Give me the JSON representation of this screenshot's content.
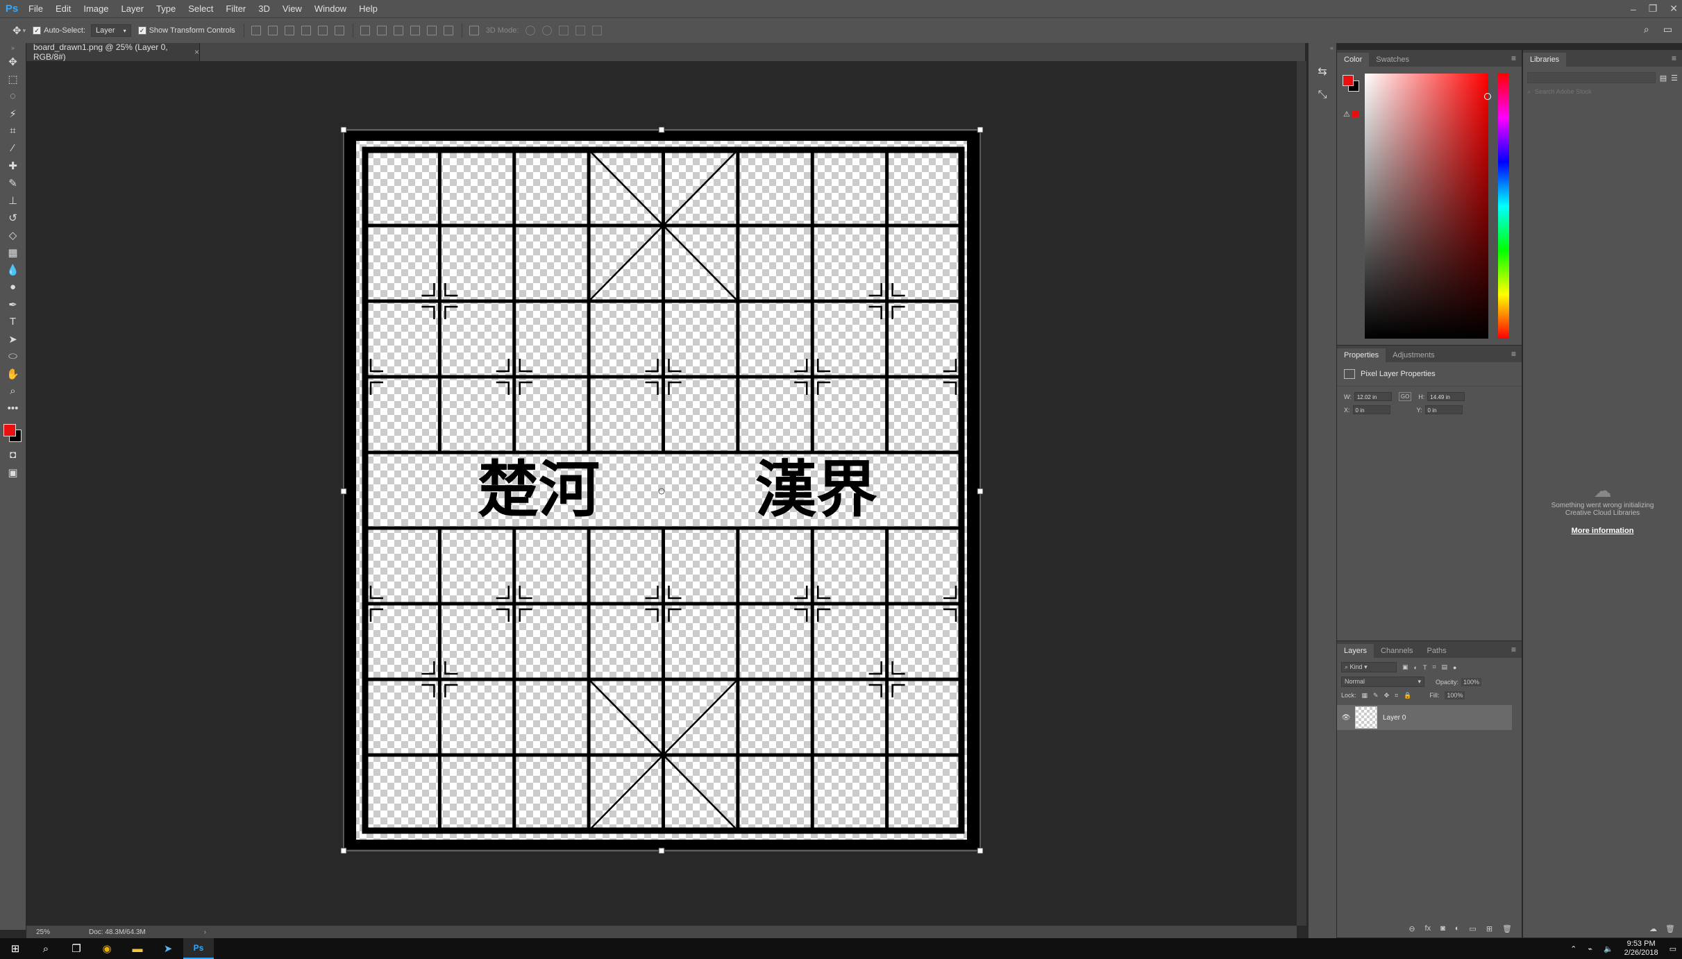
{
  "app": {
    "logo": "Ps"
  },
  "menu": [
    "File",
    "Edit",
    "Image",
    "Layer",
    "Type",
    "Select",
    "Filter",
    "3D",
    "View",
    "Window",
    "Help"
  ],
  "window_controls": [
    "–",
    "❐",
    "✕"
  ],
  "options": {
    "auto_select_label": "Auto-Select:",
    "auto_select_value": "Layer",
    "transform_label": "Show Transform Controls",
    "mode_3d_label": "3D Mode:"
  },
  "document": {
    "tab_title": "board_drawn1.png @ 25% (Layer 0, RGB/8#)",
    "tab_close": "×",
    "river_left": "楚河",
    "river_right": "漢界",
    "zoom": "25%",
    "doc_info": "Doc: 48.3M/64.3M"
  },
  "color_panel": {
    "tabs": [
      "Color",
      "Swatches"
    ],
    "fg": "#e80f0f",
    "bg": "#000000"
  },
  "properties_panel": {
    "tabs": [
      "Properties",
      "Adjustments"
    ],
    "title": "Pixel Layer Properties",
    "w_label": "W:",
    "w_value": "12.02 in",
    "h_label": "H:",
    "h_value": "14.49 in",
    "x_label": "X:",
    "x_value": "0 in",
    "y_label": "Y:",
    "y_value": "0 in",
    "link": "GO"
  },
  "layers_panel": {
    "tabs": [
      "Layers",
      "Channels",
      "Paths"
    ],
    "filter": "Kind",
    "blend": "Normal",
    "opacity_label": "Opacity:",
    "opacity": "100%",
    "lock_label": "Lock:",
    "fill_label": "Fill:",
    "fill": "100%",
    "layer_name": "Layer 0"
  },
  "libraries_panel": {
    "tab": "Libraries",
    "search_placeholder": "Search Adobe Stock",
    "error_line1": "Something went wrong initializing",
    "error_line2": "Creative Cloud Libraries",
    "more_info": "More information"
  },
  "taskbar": {
    "time": "9:53 PM",
    "date": "2/26/2018"
  }
}
